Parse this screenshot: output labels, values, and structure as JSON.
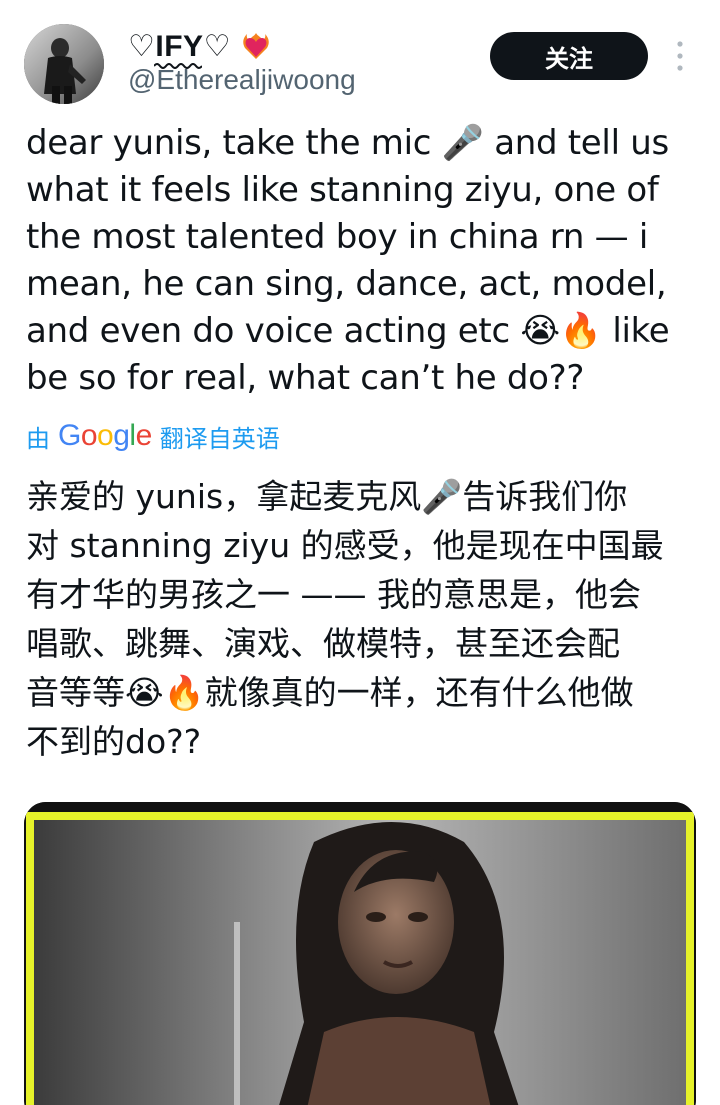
{
  "tweet": {
    "author": {
      "display_name": "♡IFY♡",
      "handle": "@Etherealjiwoong",
      "badge_icon": "heart-on-fire-icon"
    },
    "follow_button_label": "关注",
    "text_lines": "dear yunis, take the mic 🎤 and tell us\nwhat it feels like stanning ziyu, one of\nthe most talented boy in china rn — i\nmean, he can sing, dance, act, model,\nand even do voice acting etc 😭🔥 like\nbe so for real, what can’t he do??",
    "translation": {
      "by_label": "由",
      "provider": "Google",
      "source_label": "翻译自英语",
      "text": "亲爱的 yunis，拿起麦克风🎤告诉我们你\n对 stanning ziyu 的感受，他是现在中国最\n有才华的男孩之一 —— 我的意思是，他会\n唱歌、跳舞、演戏、做模特，甚至还会配\n音等等😭🔥就像真的一样，还有什么他做\n不到的do??"
    },
    "media": {
      "type": "photo",
      "border_color": "#e6f22a"
    }
  },
  "colors": {
    "text": "#0f1419",
    "secondary": "#536471",
    "accent": "#1d9bf0",
    "button_bg": "#0f1419"
  }
}
